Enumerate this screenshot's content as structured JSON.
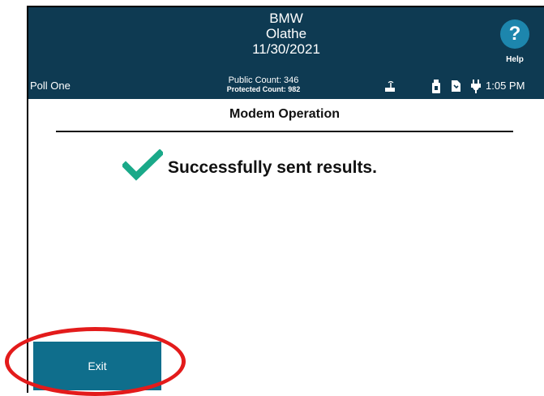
{
  "header": {
    "line1": "BMW",
    "line2": "Olathe",
    "line3": "11/30/2021",
    "help_label": "Help",
    "help_glyph": "?"
  },
  "status_bar": {
    "poll_name": "Poll One",
    "public_count": "Public Count: 346",
    "protected_count": "Protected Count: 982",
    "time": "1:05 PM",
    "icons": [
      "modem-icon",
      "usb-drive-icon",
      "document-icon",
      "power-plug-icon"
    ]
  },
  "main": {
    "title": "Modem Operation",
    "message": "Successfully sent results.",
    "message_icon": "checkmark-icon"
  },
  "footer": {
    "exit_label": "Exit"
  },
  "colors": {
    "header_bg": "#0e3a52",
    "help_button": "#1d86ad",
    "exit_button": "#0f6e8c",
    "check": "#1aa989",
    "annotation": "#e31b1b"
  }
}
